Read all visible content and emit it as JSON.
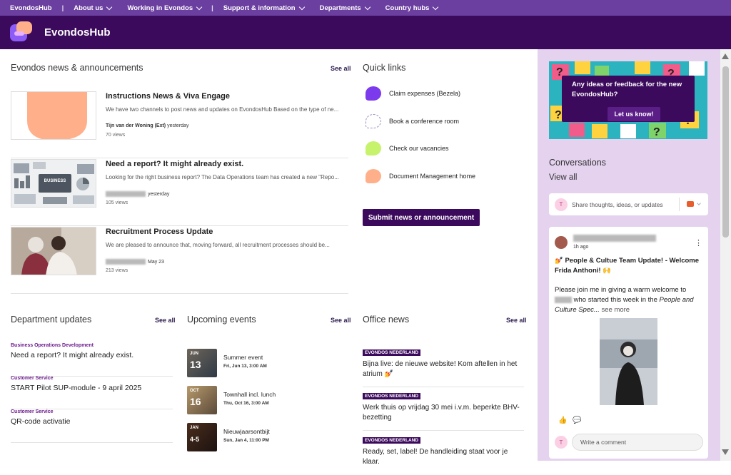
{
  "topnav": {
    "home": "EvondosHub",
    "items": [
      "About us",
      "Working in Evondos",
      "Support & information",
      "Departments",
      "Country hubs"
    ]
  },
  "header": {
    "brand": "EvondosHub"
  },
  "news": {
    "title": "Evondos news & announcements",
    "see_all": "See all",
    "items": [
      {
        "title": "Instructions News & Viva Engage",
        "desc": "We have two channels to post news and updates on EvondosHub Based on the type of ne...",
        "author": "Tijn van der Woning (Ext)",
        "date": "yesterday",
        "views": "70 views"
      },
      {
        "title": "Need a report? It might already exist.",
        "desc": "Looking for the right business report? The Data Operations team has created a new \"Repo...",
        "date": "yesterday",
        "views": "105 views"
      },
      {
        "title": "Recruitment Process Update",
        "desc": "We are pleased to announce that, moving forward, all recruitment processes should be...",
        "date": "May 23",
        "views": "213 views"
      }
    ]
  },
  "quick_links": {
    "title": "Quick links",
    "items": [
      "Claim expenses (Bezela)",
      "Book a conference room",
      "Check our vacancies",
      "Document Management home"
    ],
    "colors": [
      "#7c3aed",
      "#ffffff",
      "#c6f36b",
      "#ffb08a"
    ]
  },
  "submit_button": "Submit news or announcement",
  "department": {
    "title": "Department updates",
    "see_all": "See all",
    "items": [
      {
        "category": "Business Operations Development",
        "title": "Need a report? It might already exist."
      },
      {
        "category": "Customer Service",
        "title": "START Pilot SUP-module - 9 april 2025"
      },
      {
        "category": "Customer Service",
        "title": "QR-code activatie"
      }
    ]
  },
  "events": {
    "title": "Upcoming events",
    "see_all": "See all",
    "items": [
      {
        "month": "JUN",
        "day": "13",
        "name": "Summer event",
        "date": "Fri, Jun 13, 3:00 AM"
      },
      {
        "month": "OCT",
        "day": "16",
        "name": "Townhall incl. lunch",
        "date": "Thu, Oct 16, 3:00 AM"
      },
      {
        "month": "JAN",
        "day": "4-5",
        "name": "Nieuwjaarsontbijt",
        "date": "Sun, Jan 4, 11:00 PM"
      }
    ]
  },
  "office": {
    "title": "Office news",
    "see_all": "See all",
    "items": [
      {
        "badge": "EVONDOS NEDERLAND",
        "title": "Bijna live: de nieuwe website! Kom aftellen in het atrium 💅"
      },
      {
        "badge": "EVONDOS NEDERLAND",
        "title": "Werk thuis op vrijdag 30 mei i.v.m. beperkte BHV-bezetting"
      },
      {
        "badge": "EVONDOS NEDERLAND",
        "title": "Ready, set, label! De handleiding staat voor je klaar."
      }
    ]
  },
  "feedback": {
    "question": "Any ideas or feedback for the new EvondosHub?",
    "button": "Let us know!"
  },
  "conversations": {
    "title": "Conversations",
    "view_all": "View all",
    "share_placeholder": "Share thoughts, ideas, or updates",
    "avatar_initial": "T",
    "post": {
      "time": "1h ago",
      "title": "💅 People & Cultue Team Update! - Welcome Frida Anthoni! 🙌",
      "body_start": "Please join me in giving a warm welcome to",
      "body_mid": "who started this week in the",
      "body_italic": "People and Culture Spec...",
      "see_more": "see more",
      "comment_placeholder": "Write a comment"
    }
  }
}
